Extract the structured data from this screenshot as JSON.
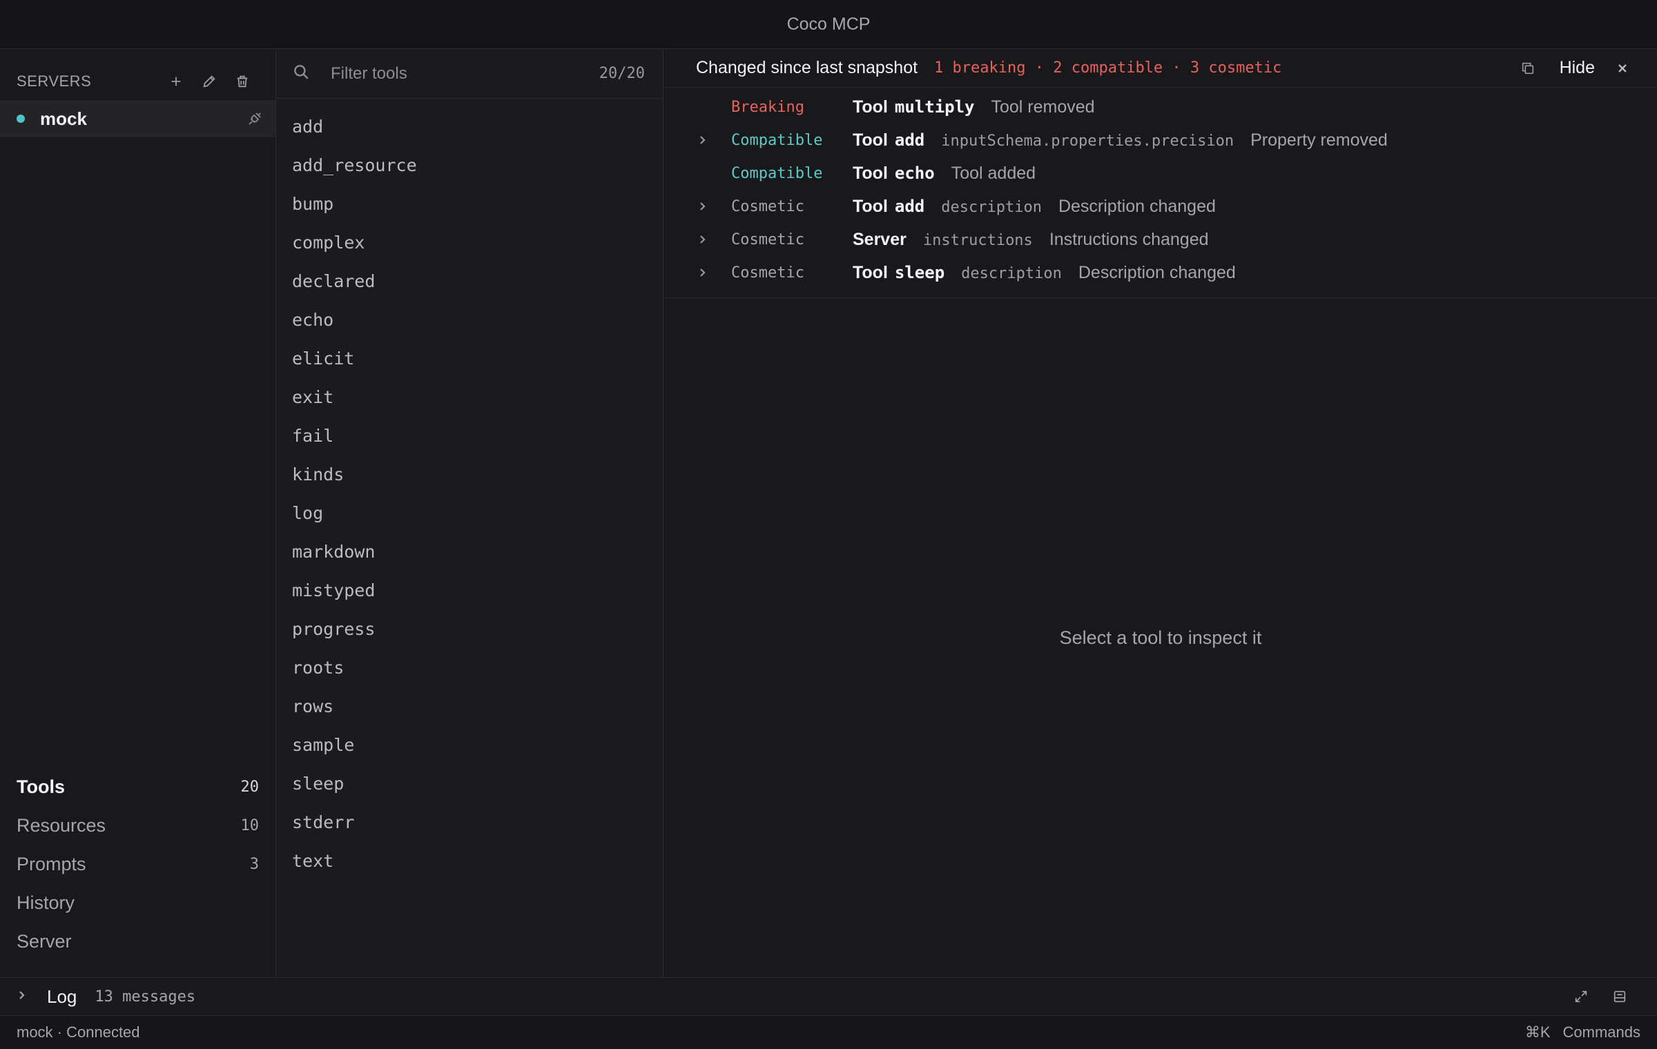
{
  "app": {
    "title": "Coco MCP"
  },
  "servers": {
    "title": "SERVERS",
    "items": [
      {
        "name": "mock",
        "status_color": "#4fc3c6"
      }
    ]
  },
  "nav": {
    "items": [
      {
        "label": "Tools",
        "count": "20",
        "active": true
      },
      {
        "label": "Resources",
        "count": "10"
      },
      {
        "label": "Prompts",
        "count": "3"
      },
      {
        "label": "History",
        "count": ""
      },
      {
        "label": "Server",
        "count": ""
      }
    ]
  },
  "filter": {
    "placeholder": "Filter tools",
    "count": "20/20"
  },
  "tools": [
    "add",
    "add_resource",
    "bump",
    "complex",
    "declared",
    "echo",
    "elicit",
    "exit",
    "fail",
    "kinds",
    "log",
    "markdown",
    "mistyped",
    "progress",
    "roots",
    "rows",
    "sample",
    "sleep",
    "stderr",
    "text"
  ],
  "banner": {
    "title": "Changed since last snapshot",
    "summary": "1 breaking · 2 compatible · 3 cosmetic",
    "hide_label": "Hide",
    "changes": [
      {
        "severity": "Breaking",
        "kind": "Tool",
        "name": "multiply",
        "path": "",
        "description": "Tool removed",
        "expandable": false
      },
      {
        "severity": "Compatible",
        "kind": "Tool",
        "name": "add",
        "path": "inputSchema.properties.precision",
        "description": "Property removed",
        "expandable": true
      },
      {
        "severity": "Compatible",
        "kind": "Tool",
        "name": "echo",
        "path": "",
        "description": "Tool added",
        "expandable": false
      },
      {
        "severity": "Cosmetic",
        "kind": "Tool",
        "name": "add",
        "path": "description",
        "description": "Description changed",
        "expandable": true
      },
      {
        "severity": "Cosmetic",
        "kind": "Server",
        "name": "",
        "path": "instructions",
        "description": "Instructions changed",
        "expandable": true
      },
      {
        "severity": "Cosmetic",
        "kind": "Tool",
        "name": "sleep",
        "path": "description",
        "description": "Description changed",
        "expandable": true
      }
    ]
  },
  "main": {
    "empty_text": "Select a tool to inspect it"
  },
  "log": {
    "title": "Log",
    "count": "13 messages"
  },
  "status": {
    "text": "mock · Connected",
    "shortcut": "⌘K",
    "commands_label": "Commands"
  },
  "colors": {
    "breaking": "#e5625f",
    "compatible": "#5ec8c8",
    "cosmetic": "#a6a6aa",
    "connected": "#4fc3c6"
  }
}
